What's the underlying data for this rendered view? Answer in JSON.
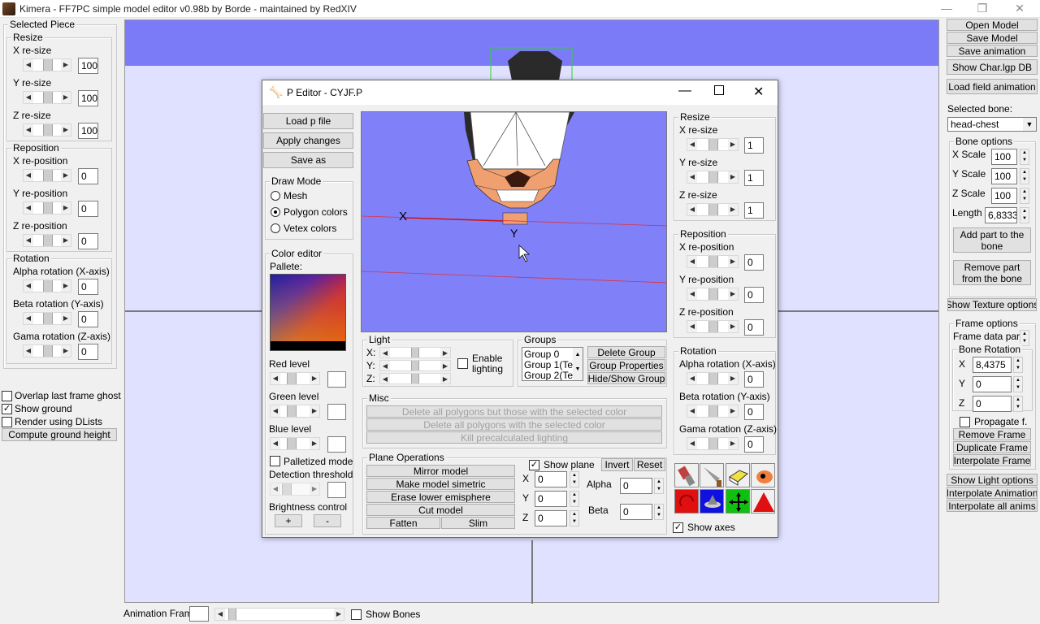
{
  "window": {
    "title": "Kimera - FF7PC simple model editor v0.98b by Borde - maintained by RedXIV",
    "min": "—",
    "max": "❐",
    "close": "✕"
  },
  "left": {
    "selected_piece": "Selected Piece",
    "resize": "Resize",
    "x_resize": "X re-size",
    "y_resize": "Y re-size",
    "z_resize": "Z re-size",
    "x_val": "100",
    "y_val": "100",
    "z_val": "100",
    "reposition": "Reposition",
    "x_repos": "X re-position",
    "y_repos": "Y re-position",
    "z_repos": "Z re-position",
    "xr_val": "0",
    "yr_val": "0",
    "zr_val": "0",
    "rotation": "Rotation",
    "alpha": "Alpha rotation (X-axis)",
    "beta": "Beta rotation (Y-axis)",
    "gama": "Gama rotation (Z-axis)",
    "alpha_val": "0",
    "beta_val": "0",
    "gama_val": "0",
    "overlap": "Overlap last frame ghost",
    "show_ground": "Show ground",
    "render_dlists": "Render using DLists",
    "compute_ground": "Compute ground height"
  },
  "right": {
    "open_model": "Open Model",
    "save_model": "Save Model",
    "save_animation": "Save animation",
    "show_char": "Show Char.lgp DB",
    "load_field": "Load field animation",
    "selected_bone": "Selected bone:",
    "bone_value": "head-chest",
    "bone_options": "Bone options",
    "x_scale": "X Scale",
    "y_scale": "Y Scale",
    "z_scale": "Z Scale",
    "length": "Length",
    "x_scale_val": "100",
    "y_scale_val": "100",
    "z_scale_val": "100",
    "length_val": "6,83333",
    "add_part": "Add part to the bone",
    "remove_part": "Remove part from the bone",
    "show_texture": "Show Texture options",
    "frame_options": "Frame options",
    "frame_data_part": "Frame data part",
    "bone_rotation": "Bone Rotation",
    "rx": "X",
    "ry": "Y",
    "rz": "Z",
    "rx_val": "8,4375",
    "ry_val": "0",
    "rz_val": "0",
    "propagate": "Propagate f.",
    "remove_frame": "Remove Frame",
    "duplicate_frame": "Duplicate Frame",
    "interpolate_frame": "Interpolate Frame",
    "show_light": "Show Light options",
    "interpolate_anim": "Interpolate Animation",
    "interpolate_all": "Interpolate all anims"
  },
  "bottom": {
    "animation_frame": "Animation Frame",
    "show_bones": "Show Bones"
  },
  "peditor": {
    "title": "P Editor - CYJF.P",
    "load_p": "Load p file",
    "apply": "Apply changes",
    "save_as": "Save as",
    "draw_mode": "Draw Mode",
    "mesh": "Mesh",
    "poly_colors": "Polygon colors",
    "vertex_colors": "Vetex colors",
    "color_editor": "Color editor",
    "pallete": "Pallete:",
    "red": "Red level",
    "green": "Green level",
    "blue": "Blue level",
    "palletized": "Palletized mode",
    "detection": "Detection threshold",
    "brightness": "Brightness control",
    "plus": "+",
    "minus": "-",
    "light": "Light",
    "lx": "X:",
    "ly": "Y:",
    "lz": "Z:",
    "enable_lighting": "Enable lighting",
    "groups": "Groups",
    "group_items": [
      "Group  0",
      "Group  1(Te",
      "Group  2(Te"
    ],
    "delete_group": "Delete Group",
    "group_props": "Group Properties",
    "hide_show": "Hide/Show Group",
    "misc": "Misc",
    "del_but_selected": "Delete all polygons but those with the selected color",
    "del_selected": "Delete all polygons with the selected color",
    "kill_light": "Kill precalculated lighting",
    "plane_ops": "Plane Operations",
    "mirror": "Mirror model",
    "make_sym": "Make model simetric",
    "erase_lower": "Erase lower emisphere",
    "cut": "Cut model",
    "fatten": "Fatten",
    "slim": "Slim",
    "show_plane": "Show plane",
    "invert": "Invert",
    "reset": "Reset",
    "px": "X",
    "py": "Y",
    "pz": "Z",
    "px_val": "0",
    "py_val": "0",
    "pz_val": "0",
    "alpha": "Alpha",
    "beta": "Beta",
    "alpha_val": "0",
    "beta_val": "0",
    "resize": "Resize",
    "x_resize": "X re-size",
    "y_resize": "Y re-size",
    "z_resize": "Z re-size",
    "rx_val": "1",
    "ry_val": "1",
    "rz_val": "1",
    "reposition": "Reposition",
    "x_repos": "X re-position",
    "y_repos": "Y re-position",
    "z_repos": "Z re-position",
    "px2": "0",
    "py2": "0",
    "pz2": "0",
    "rotation": "Rotation",
    "alpha_rot": "Alpha rotation (X-axis)",
    "beta_rot": "Beta rotation (Y-axis)",
    "gama_rot": "Gama rotation (Z-axis)",
    "ar_val": "0",
    "br_val": "0",
    "gr_val": "0",
    "show_axes": "Show axes",
    "axis_x": "X",
    "axis_y": "Y"
  }
}
